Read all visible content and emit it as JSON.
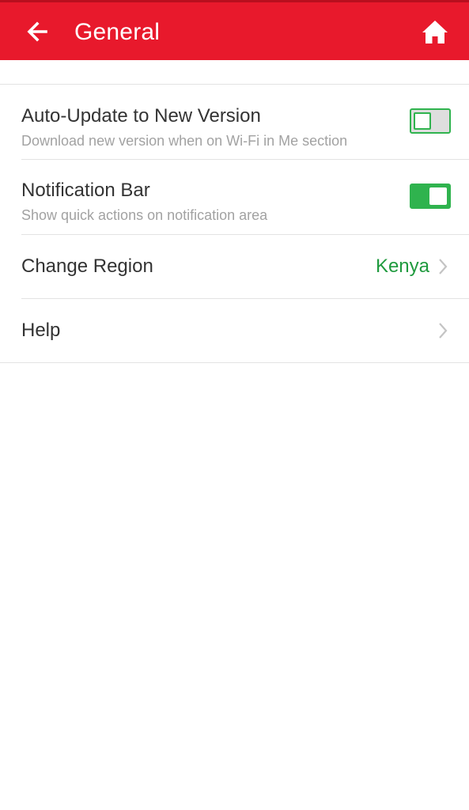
{
  "header": {
    "title": "General",
    "back_icon": "arrow-left-icon",
    "home_icon": "home-icon",
    "background_color": "#e8192c"
  },
  "settings": [
    {
      "title": "Auto-Update to New Version",
      "subtitle": "Download new version when on Wi-Fi in Me section",
      "control": "toggle",
      "enabled": false
    },
    {
      "title": "Notification Bar",
      "subtitle": "Show quick actions on notification area",
      "control": "toggle",
      "enabled": true
    },
    {
      "title": "Change Region",
      "value": "Kenya",
      "control": "chevron-right-icon"
    },
    {
      "title": "Help",
      "control": "chevron-right-icon"
    }
  ],
  "colors": {
    "accent_green": "#2fb34e",
    "value_green": "#1f9a3e"
  }
}
